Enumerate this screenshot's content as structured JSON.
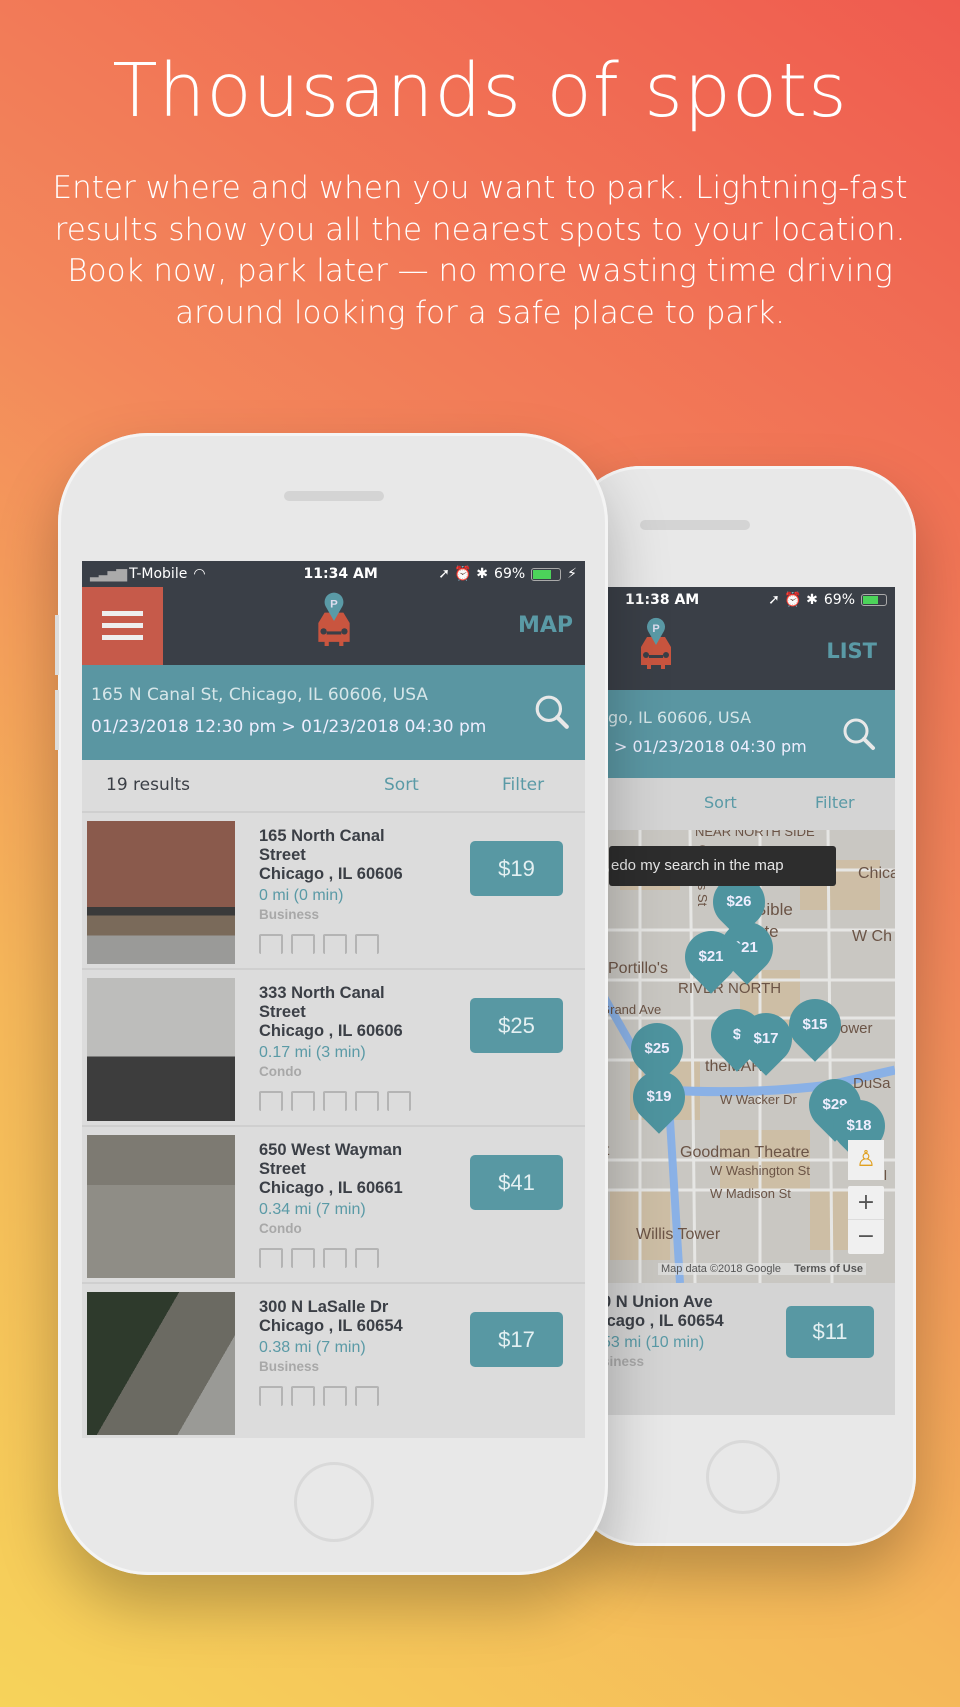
{
  "headline": {
    "title": "Thousands of spots",
    "subtitle": "Enter where and when you want to park. Lightning-fast results show you all the nearest spots to your location. Book now, park later — no more wasting time driving around looking for a safe place to park."
  },
  "colors": {
    "header": "#3a3f47",
    "accent": "#5a96a2",
    "menu": "#c65a4a",
    "logo_car": "#c9553f"
  },
  "front": {
    "status": {
      "carrier": "T-Mobile",
      "time": "11:34 AM",
      "battery": "69%"
    },
    "header": {
      "menu_icon": "hamburger-icon",
      "logo": "car-parking-pin-logo",
      "map_label": "MAP"
    },
    "search": {
      "location": "165 N Canal St, Chicago, IL 60606, USA",
      "dates": "01/23/2018 12:30 pm > 01/23/2018 04:30 pm"
    },
    "results": {
      "count": "19 results",
      "sort": "Sort",
      "filter": "Filter"
    },
    "listings": [
      {
        "line1": "165 North Canal",
        "line2": "Street",
        "line3": "Chicago , IL 60606",
        "distance": "0 mi (0 min)",
        "type": "Business",
        "price": "$19",
        "amenities": [
          "garage",
          "thermometer",
          "covered",
          "ev-charging"
        ]
      },
      {
        "line1": "333 North Canal",
        "line2": "Street",
        "line3": "Chicago , IL 60606",
        "distance": "0.17 mi (3 min)",
        "type": "Condo",
        "price": "$25",
        "amenities": [
          "security-camera",
          "garage",
          "thermometer",
          "accessible",
          "covered"
        ]
      },
      {
        "line1": "650 West Wayman",
        "line2": "Street",
        "line3": "Chicago , IL 60661",
        "distance": "0.34 mi (7 min)",
        "type": "Condo",
        "price": "$41",
        "amenities": [
          "garage",
          "thermometer",
          "covered",
          "ev-charging"
        ]
      },
      {
        "line1": "300 N LaSalle Dr",
        "line2": "Chicago , IL 60654",
        "line3": "",
        "distance": "0.38 mi (7 min)",
        "type": "Business",
        "price": "$17",
        "amenities": [
          "security-camera",
          "garage",
          "covered",
          "ev-charging"
        ]
      }
    ]
  },
  "back": {
    "status": {
      "time": "11:38 AM",
      "battery": "69%"
    },
    "header": {
      "list_label": "LIST"
    },
    "search": {
      "location": "go, IL 60606, USA",
      "dates": "> 01/23/2018 04:30 pm"
    },
    "results": {
      "sort": "Sort",
      "filter": "Filter"
    },
    "map": {
      "redo": "edo my search in the map",
      "attribution": "Map data ©2018 Google",
      "terms": "Terms of Use",
      "labels": [
        "NEAR NORTH SIDE",
        "Chicago",
        "Bible",
        "ute",
        "W Ch",
        "Orleans St",
        "Portillo's",
        "RIVER NORTH",
        "Grand Ave",
        "ower",
        "theMART",
        "DuSa",
        "W Wacker Dr",
        "Goodman Theatre",
        "W Washington St",
        "W Madison St",
        "Willis Tower",
        "Mill",
        "et"
      ],
      "markers": [
        "$26",
        "$21",
        "`21",
        "$25",
        "$19",
        "$",
        "$17",
        "$15",
        "$29",
        "$18"
      ],
      "zoom_in": "+",
      "zoom_out": "−"
    },
    "listing": {
      "line1": "0 N Union Ave",
      "line2": "icago , IL 60654",
      "distance": "53 mi (10 min)",
      "type": "siness",
      "price": "$11"
    }
  }
}
